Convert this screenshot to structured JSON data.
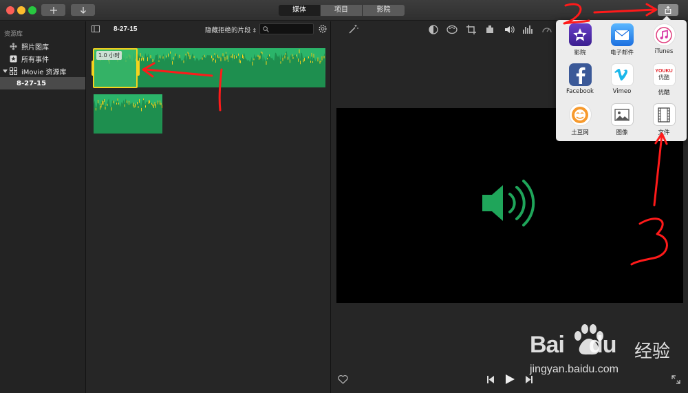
{
  "titlebar": {
    "tabs": [
      {
        "label": "媒体",
        "active": true
      },
      {
        "label": "项目",
        "active": false
      },
      {
        "label": "影院",
        "active": false
      }
    ]
  },
  "sidebar": {
    "header": "资源库",
    "items": [
      {
        "label": "照片图库",
        "icon": "flower-icon"
      },
      {
        "label": "所有事件",
        "icon": "star-icon"
      },
      {
        "label": "iMovie 资源库",
        "icon": "grid-icon"
      },
      {
        "label": "8-27-15",
        "icon": "",
        "selected": true
      }
    ]
  },
  "browser": {
    "event_title": "8-27-15",
    "filter_label": "隐藏拒绝的片段",
    "search_placeholder": "",
    "clip_duration": "1.0 小时"
  },
  "share_popover": {
    "items": [
      {
        "label": "影院",
        "icon": "imovie-theater-icon"
      },
      {
        "label": "电子邮件",
        "icon": "mail-icon"
      },
      {
        "label": "iTunes",
        "icon": "itunes-icon"
      },
      {
        "label": "Facebook",
        "icon": "facebook-icon"
      },
      {
        "label": "Vimeo",
        "icon": "vimeo-icon"
      },
      {
        "label": "优酷",
        "icon": "youku-icon"
      },
      {
        "label": "土豆网",
        "icon": "tudou-icon"
      },
      {
        "label": "图像",
        "icon": "image-icon"
      },
      {
        "label": "文件",
        "icon": "film-icon"
      }
    ],
    "youku_logo_text": "YOUKU",
    "youku_sub": "优酷"
  },
  "annotations": {
    "marks": [
      "1",
      "2",
      "3"
    ],
    "watermark_brand": "Bai",
    "watermark_brand2": "du",
    "watermark_cn": "经验",
    "watermark_url": "jingyan.baidu.com"
  },
  "colors": {
    "accent_green": "#2bb56a",
    "selection_yellow": "#f5d31e",
    "annotation_red": "#ff1a1a"
  }
}
